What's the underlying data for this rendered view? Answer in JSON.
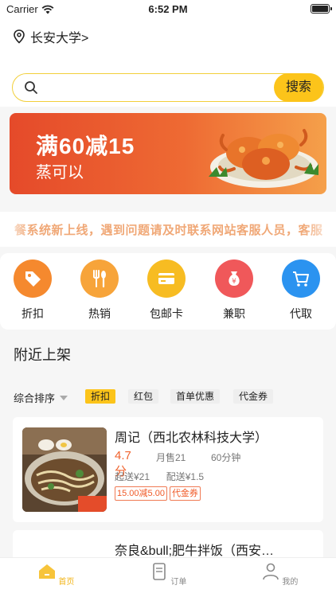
{
  "status_bar": {
    "carrier": "Carrier",
    "time": "6:52 PM"
  },
  "location": {
    "text": "长安大学>"
  },
  "search": {
    "placeholder": "",
    "button_label": "搜索"
  },
  "banner": {
    "title": "满60减15",
    "subtitle": "蒸可以"
  },
  "notice": {
    "text": "餐系统新上线，遇到问题请及时联系网站客服人员，客服"
  },
  "categories": [
    {
      "label": "折扣",
      "icon": "discount-tag-icon",
      "color": "#f5892e"
    },
    {
      "label": "热销",
      "icon": "fork-spoon-icon",
      "color": "#f7a43a"
    },
    {
      "label": "包邮卡",
      "icon": "card-icon",
      "color": "#f7bc22"
    },
    {
      "label": "兼职",
      "icon": "money-bag-icon",
      "color": "#f0585a"
    },
    {
      "label": "代取",
      "icon": "cart-icon",
      "color": "#2b93f0"
    }
  ],
  "section": {
    "title": "附近上架"
  },
  "filters": {
    "sort_label": "综合排序",
    "chips": [
      "折扣",
      "红包",
      "首单优惠",
      "代金券"
    ]
  },
  "stores": [
    {
      "name": "周记（西北农林科技大学）",
      "rating": "4.7分",
      "sales": "月售21",
      "time": "60分钟",
      "min_order": "起送¥21",
      "delivery_fee": "配送¥1.5",
      "tags": [
        "15.00减5.00",
        "代金券"
      ]
    },
    {
      "name": "奈良&bull;肥牛拌饭（西安…"
    }
  ],
  "tab_bar": {
    "items": [
      {
        "label": "首页",
        "icon": "home-icon"
      },
      {
        "label": "订单",
        "icon": "order-icon"
      },
      {
        "label": "我的",
        "icon": "person-icon"
      }
    ]
  },
  "colors": {
    "accent": "#fcc41a",
    "price_red": "#f0622c"
  }
}
